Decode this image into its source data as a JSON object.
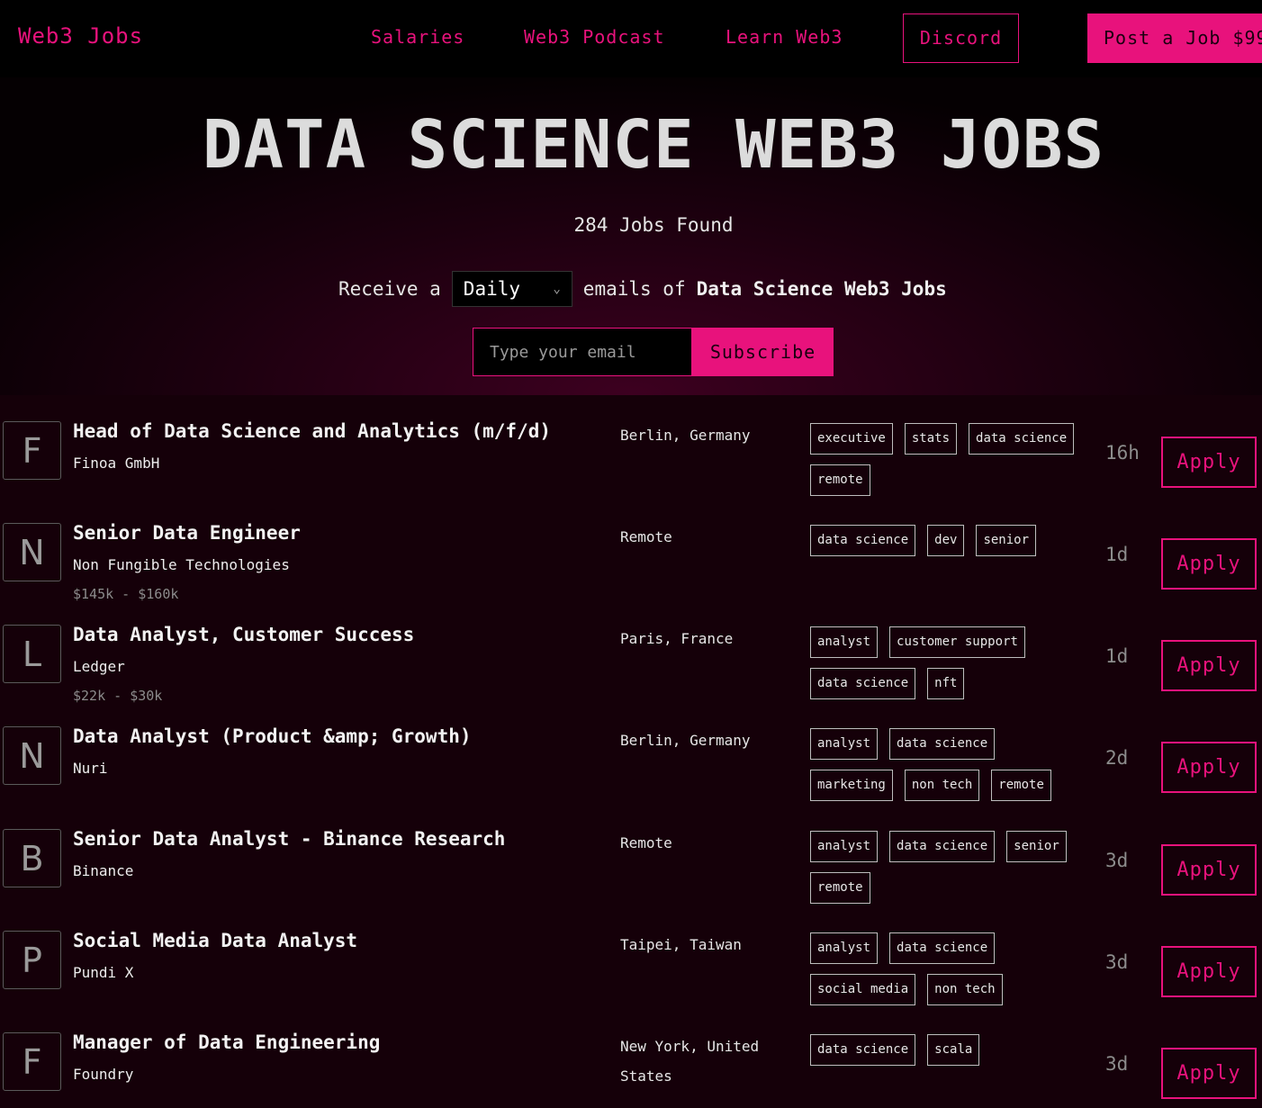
{
  "header": {
    "logo": "Web3 Jobs",
    "nav": [
      "Salaries",
      "Web3 Podcast",
      "Learn Web3"
    ],
    "discord": "Discord",
    "post_job": "Post a Job $99"
  },
  "hero": {
    "title": "DATA SCIENCE WEB3 JOBS",
    "jobs_found": "284 Jobs Found",
    "receive_prefix": "Receive a",
    "frequency": "Daily",
    "receive_middle": "emails of",
    "receive_topic": "Data Science Web3 Jobs",
    "email_placeholder": "Type your email",
    "subscribe": "Subscribe"
  },
  "jobs": [
    {
      "initial": "F",
      "title": "Head of Data Science and Analytics (m/f/d)",
      "company": "Finoa GmbH",
      "salary": "",
      "location": "Berlin, Germany",
      "tags": [
        "executive",
        "stats",
        "data science",
        "remote"
      ],
      "age": "16h",
      "apply": "Apply"
    },
    {
      "initial": "N",
      "title": "Senior Data Engineer",
      "company": "Non Fungible Technologies",
      "salary": "$145k - $160k",
      "location": "Remote",
      "tags": [
        "data science",
        "dev",
        "senior"
      ],
      "age": "1d",
      "apply": "Apply"
    },
    {
      "initial": "L",
      "title": "Data Analyst, Customer Success",
      "company": "Ledger",
      "salary": "$22k - $30k",
      "location": "Paris, France",
      "tags": [
        "analyst",
        "customer support",
        "data science",
        "nft"
      ],
      "age": "1d",
      "apply": "Apply"
    },
    {
      "initial": "N",
      "title": "Data Analyst (Product &amp; Growth)",
      "company": "Nuri",
      "salary": "",
      "location": "Berlin, Germany",
      "tags": [
        "analyst",
        "data science",
        "marketing",
        "non tech",
        "remote"
      ],
      "age": "2d",
      "apply": "Apply"
    },
    {
      "initial": "B",
      "title": "Senior Data Analyst - Binance Research",
      "company": "Binance",
      "salary": "",
      "location": "Remote",
      "tags": [
        "analyst",
        "data science",
        "senior",
        "remote"
      ],
      "age": "3d",
      "apply": "Apply"
    },
    {
      "initial": "P",
      "title": "Social Media Data Analyst",
      "company": "Pundi X",
      "salary": "",
      "location": "Taipei, Taiwan",
      "tags": [
        "analyst",
        "data science",
        "social media",
        "non tech"
      ],
      "age": "3d",
      "apply": "Apply"
    },
    {
      "initial": "F",
      "title": "Manager of Data Engineering",
      "company": "Foundry",
      "salary": "",
      "location": "New York, United States",
      "tags": [
        "data science",
        "scala"
      ],
      "age": "3d",
      "apply": "Apply"
    }
  ]
}
